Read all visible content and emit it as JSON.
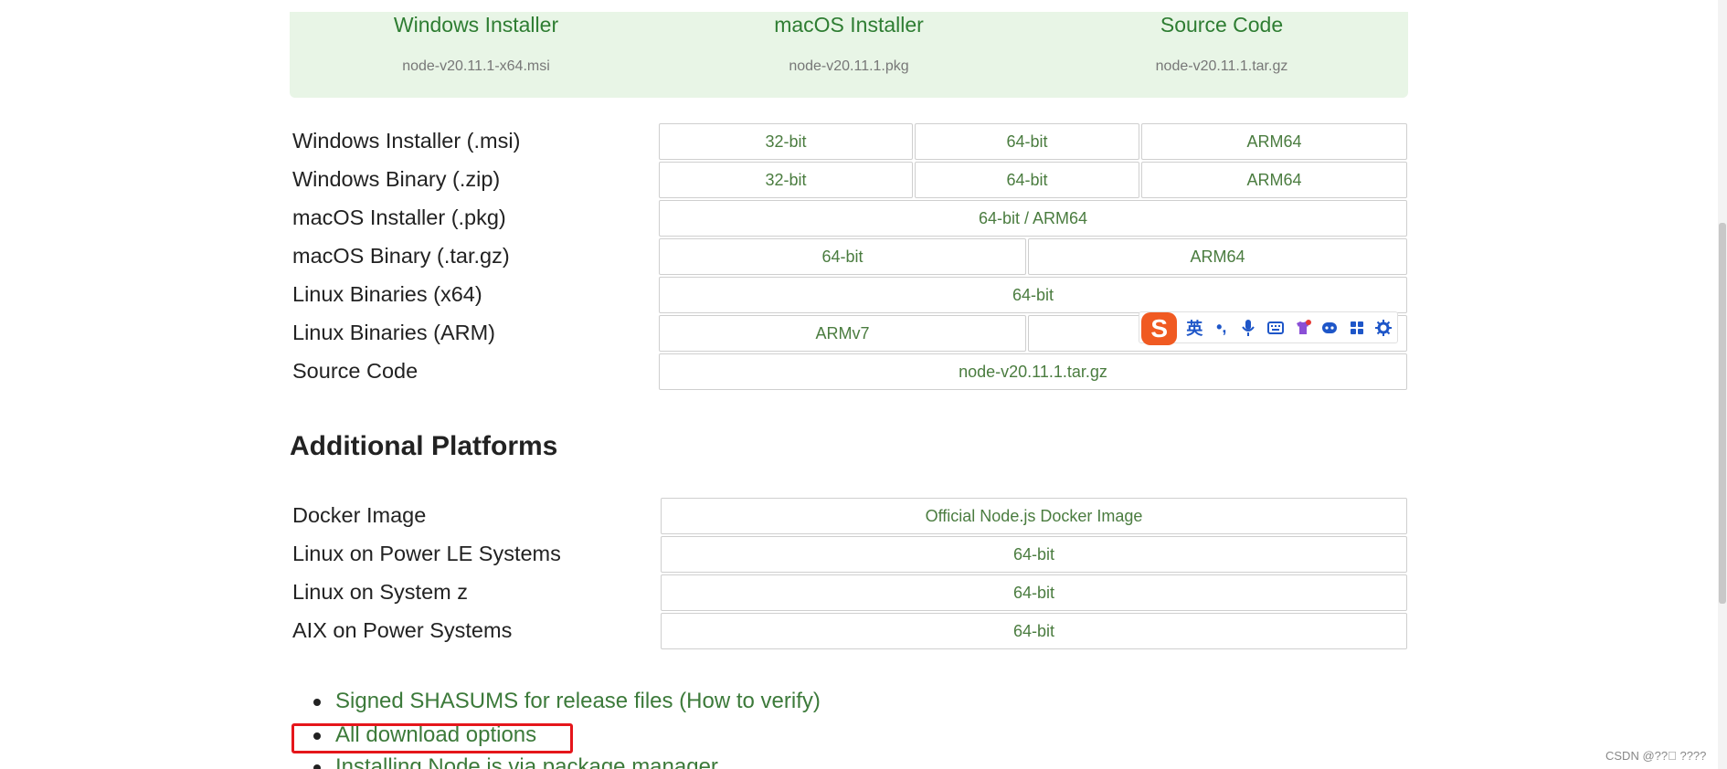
{
  "banner": [
    {
      "title": "Windows Installer",
      "file": "node-v20.11.1-x64.msi"
    },
    {
      "title": "macOS Installer",
      "file": "node-v20.11.1.pkg"
    },
    {
      "title": "Source Code",
      "file": "node-v20.11.1.tar.gz"
    }
  ],
  "downloads": [
    {
      "label": "Windows Installer (.msi)",
      "cells": [
        "32-bit",
        "64-bit",
        "ARM64"
      ]
    },
    {
      "label": "Windows Binary (.zip)",
      "cells": [
        "32-bit",
        "64-bit",
        "ARM64"
      ]
    },
    {
      "label": "macOS Installer (.pkg)",
      "cells": [
        "64-bit / ARM64"
      ]
    },
    {
      "label": "macOS Binary (.tar.gz)",
      "cells": [
        "64-bit",
        "ARM64"
      ]
    },
    {
      "label": "Linux Binaries (x64)",
      "cells": [
        "64-bit"
      ]
    },
    {
      "label": "Linux Binaries (ARM)",
      "cells": [
        "ARMv7",
        ""
      ]
    },
    {
      "label": "Source Code",
      "cells": [
        "node-v20.11.1.tar.gz"
      ]
    }
  ],
  "additional": {
    "heading": "Additional Platforms",
    "rows": [
      {
        "label": "Docker Image",
        "cells": [
          "Official Node.js Docker Image"
        ]
      },
      {
        "label": "Linux on Power LE Systems",
        "cells": [
          "64-bit"
        ]
      },
      {
        "label": "Linux on System z",
        "cells": [
          "64-bit"
        ]
      },
      {
        "label": "AIX on Power Systems",
        "cells": [
          "64-bit"
        ]
      }
    ]
  },
  "links": [
    "Signed SHASUMS for release files (How to verify)",
    "All download options",
    "Installing Node.js via package manager"
  ],
  "ime": {
    "logo": "S",
    "mode": "英",
    "punct": "•,",
    "icons": [
      "mic-icon",
      "keyboard-icon",
      "skin-icon",
      "emoji-icon",
      "apps-icon",
      "settings-icon"
    ],
    "brand_color": "#f05a22",
    "icon_color": "#1e56c8"
  },
  "watermark": "CSDN @??\u0000 ????",
  "colors": {
    "banner_bg": "#e8f5e6",
    "link_green": "#3c7a3a",
    "highlight_red": "#e5161b"
  }
}
